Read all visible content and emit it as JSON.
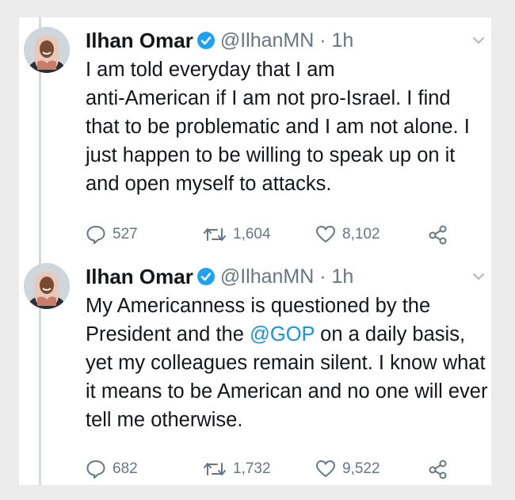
{
  "tweets": [
    {
      "name": "Ilhan Omar",
      "handle": "@IlhanMN · 1h",
      "text_before": "I am told everyday that I am\nanti-American if I am not pro-Israel. I find that to be problematic and I am not alone. I just happen to be willing to speak up on it and open myself to attacks.",
      "mention": "",
      "text_after": "",
      "replies": "527",
      "retweets": "1,604",
      "likes": "8,102"
    },
    {
      "name": "Ilhan Omar",
      "handle": "@IlhanMN · 1h",
      "text_before": "My Americanness is questioned by the President and the ",
      "mention": "@GOP",
      "text_after": " on a daily basis, yet my colleagues remain silent. I know what it means to be American and no one will ever tell me otherwise.",
      "replies": "682",
      "retweets": "1,732",
      "likes": "9,522"
    }
  ],
  "icons": {
    "verified": "verified-badge-icon",
    "chevron": "chevron-down-icon",
    "reply": "reply-icon",
    "retweet": "retweet-icon",
    "like": "heart-icon",
    "share": "share-icon"
  },
  "colors": {
    "text": "#14171a",
    "secondary": "#657786",
    "link": "#1b95e0",
    "verified": "#1da1f2"
  }
}
